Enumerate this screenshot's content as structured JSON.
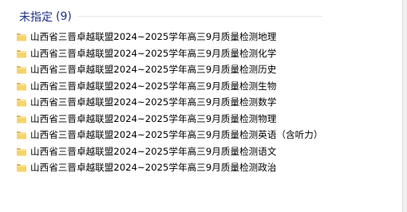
{
  "group": {
    "title": "未指定",
    "count": "(9)"
  },
  "colors": {
    "header_text": "#1e3287",
    "folder_body": "#f6d36b",
    "folder_tab": "#e2b33f"
  },
  "items": [
    {
      "name": "山西省三晋卓越联盟2024~2025学年高三9月质量检测地理",
      "icon": "folder-icon"
    },
    {
      "name": "山西省三晋卓越联盟2024~2025学年高三9月质量检测化学",
      "icon": "folder-icon"
    },
    {
      "name": "山西省三晋卓越联盟2024~2025学年高三9月质量检测历史",
      "icon": "folder-icon"
    },
    {
      "name": "山西省三晋卓越联盟2024~2025学年高三9月质量检测生物",
      "icon": "folder-icon"
    },
    {
      "name": "山西省三晋卓越联盟2024~2025学年高三9月质量检测数学",
      "icon": "folder-icon"
    },
    {
      "name": "山西省三晋卓越联盟2024~2025学年高三9月质量检测物理",
      "icon": "folder-icon"
    },
    {
      "name": "山西省三晋卓越联盟2024~2025学年高三9月质量检测英语（含听力）",
      "icon": "folder-icon"
    },
    {
      "name": "山西省三晋卓越联盟2024~2025学年高三9月质量检测语文",
      "icon": "folder-icon"
    },
    {
      "name": "山西省三晋卓越联盟2024~2025学年高三9月质量检测政治",
      "icon": "folder-icon"
    }
  ]
}
